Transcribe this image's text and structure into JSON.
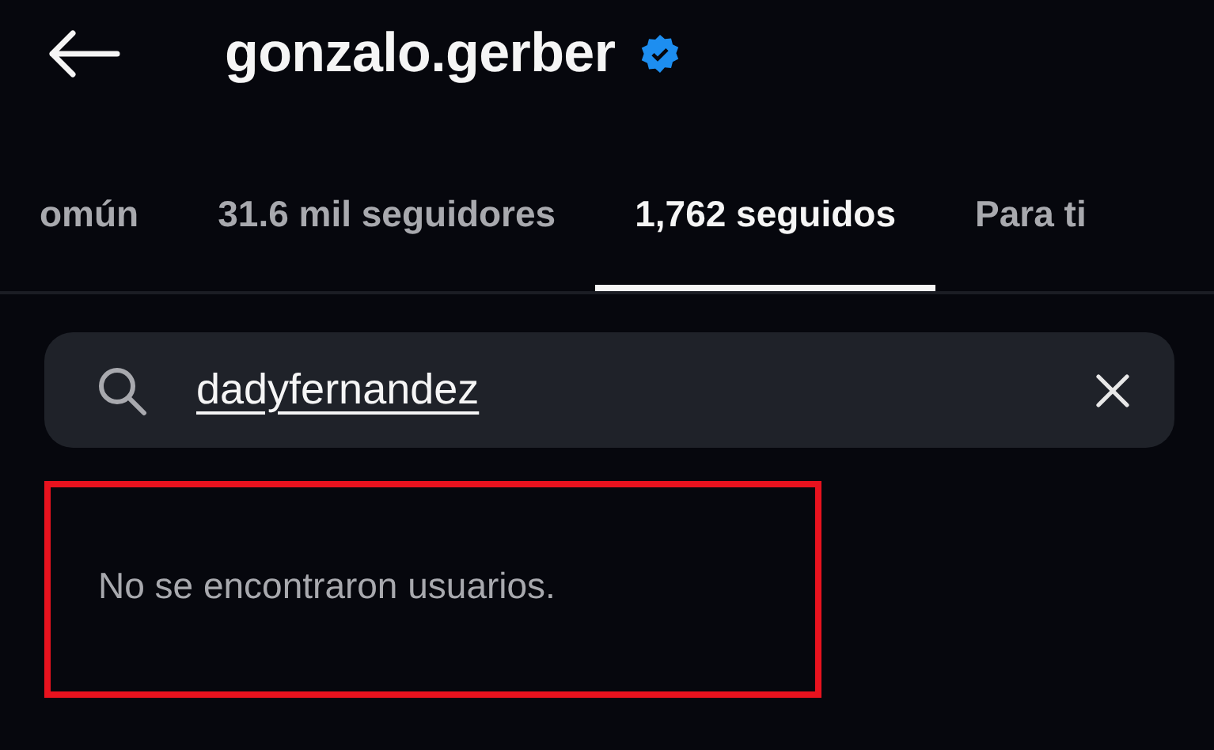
{
  "header": {
    "title": "gonzalo.gerber",
    "verified": true
  },
  "tabs": [
    {
      "label": "omún",
      "selected": false
    },
    {
      "label": "31.6 mil seguidores",
      "selected": false
    },
    {
      "label": "1,762 seguidos",
      "selected": true
    },
    {
      "label": "Para ti",
      "selected": false
    }
  ],
  "search": {
    "value": "dadyfernandez"
  },
  "result": {
    "message": "No se encontraron usuarios.",
    "highlighted": true
  }
}
